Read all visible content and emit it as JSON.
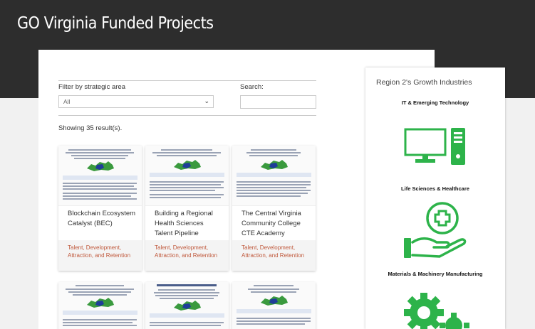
{
  "page": {
    "title": "GO Virginia Funded Projects"
  },
  "filter": {
    "label": "Filter by strategic area",
    "selected": "All"
  },
  "search": {
    "label": "Search:",
    "value": ""
  },
  "results": {
    "summary": "Showing 35 result(s)."
  },
  "cards": [
    {
      "title": "Blockchain Ecosystem Catalyst (BEC)",
      "tag": "Talent, Development, Attraction, and Retention"
    },
    {
      "title": "Building a Regional Health Sciences Talent Pipeline",
      "tag": "Talent, Development, Attraction, and Retention"
    },
    {
      "title": "The Central Virginia Community College CTE Academy",
      "tag": "Talent, Development, Attraction, and Retention"
    },
    {
      "title": "",
      "tag": ""
    },
    {
      "title": "",
      "tag": ""
    },
    {
      "title": "",
      "tag": ""
    }
  ],
  "sidebar": {
    "title": "Region 2's Growth Industries",
    "industries": [
      {
        "label": "IT & Emerging Technology",
        "icon": "computer-icon"
      },
      {
        "label": "Life Sciences & Healthcare",
        "icon": "healthcare-hand-icon"
      },
      {
        "label": "Materials & Machinery Manufacturing",
        "icon": "gears-icon"
      }
    ]
  },
  "colors": {
    "hero": "#2d2d2d",
    "accent_green": "#2db34a",
    "tag": "#c0593c",
    "map_green": "#3a9a3e",
    "map_blue": "#1f3d99"
  }
}
